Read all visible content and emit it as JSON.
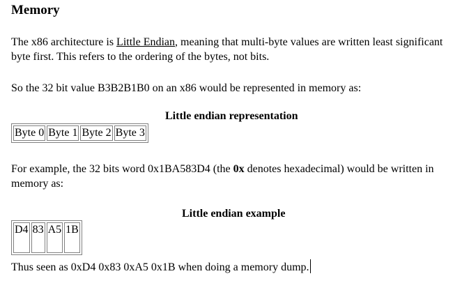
{
  "heading": "Memory",
  "intro": {
    "before_link": "The x86 architecture is ",
    "link": "Little Endian",
    "after_link": ", meaning that multi-byte values are written least significant byte first. This refers to the ordering of the bytes, not bits."
  },
  "value_sentence": "So the 32 bit value B3B2B1B0 on an x86 would be represented in memory as:",
  "representation": {
    "caption": "Little endian representation",
    "cells": [
      "Byte 0",
      "Byte 1",
      "Byte 2",
      "Byte 3"
    ]
  },
  "example_sentence": {
    "before_bold": "For example, the 32 bits word 0x1BA583D4 (the ",
    "bold": "0x",
    "after_bold": " denotes hexadecimal) would be written in memory as:"
  },
  "example": {
    "caption": "Little endian example",
    "cells": [
      "D4",
      "83",
      "A5",
      "1B"
    ]
  },
  "dump_sentence": "Thus seen as 0xD4 0x83 0xA5 0x1B when doing a memory dump."
}
